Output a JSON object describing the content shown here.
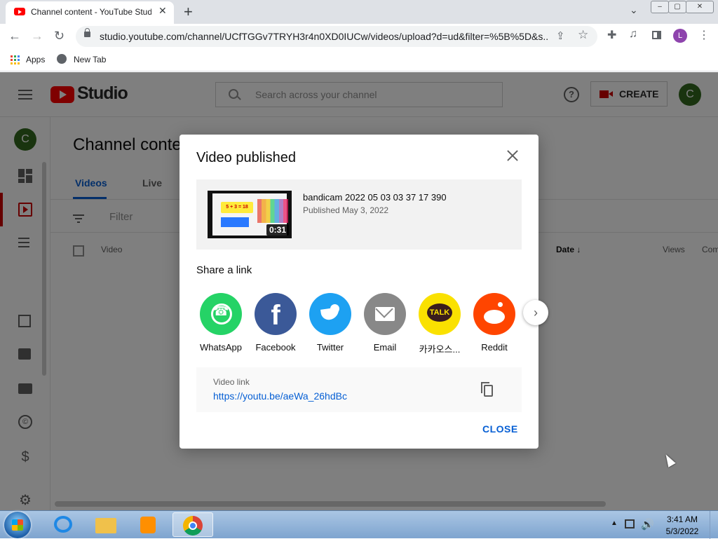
{
  "browser": {
    "tab_title": "Channel content - YouTube Studio",
    "tab_close": "✕",
    "new_tab": "+",
    "tab_search": "⌄",
    "window_min": "–",
    "window_max": "▢",
    "window_close": "✕",
    "back": "←",
    "forward": "→",
    "reload": "↻",
    "url": "studio.youtube.com/channel/UCfTGGv7TRYH3r4n0XD0IUCw/videos/upload?d=ud&filter=%5B%5D&s...",
    "share": "⇪",
    "star": "☆",
    "extensions": "✚",
    "media": "♫",
    "profile_initial": "L",
    "menu": "⋮",
    "profile_color": "#8e44ad"
  },
  "bookmarks": {
    "apps": "Apps",
    "new_tab": "New Tab"
  },
  "studio": {
    "logo_text": "Studio",
    "search_placeholder": "Search across your channel",
    "help": "?",
    "create_label": "CREATE",
    "avatar_initial": "C",
    "page_title": "Channel content",
    "tabs": [
      "Videos",
      "Live"
    ],
    "filter_label": "Filter",
    "columns": {
      "video": "Video",
      "date": "Date ↓",
      "views": "Views",
      "comments": "Com"
    },
    "sidebar_icons": {
      "copyright": "©",
      "earn": "$",
      "settings": "⚙"
    },
    "accent_color": "#cc0000"
  },
  "dialog": {
    "title": "Video published",
    "video_name": "bandicam 2022 05 03 03 37 17 390",
    "published": "Published May 3, 2022",
    "duration": "0:31",
    "thumb_text": "5 + 3 = 18",
    "share_heading": "Share a link",
    "share_targets": [
      {
        "label": "WhatsApp",
        "icon": "whatsapp-icon",
        "color": "#25d366"
      },
      {
        "label": "Facebook",
        "icon": "facebook-icon",
        "color": "#3b5998",
        "glyph": "f"
      },
      {
        "label": "Twitter",
        "icon": "twitter-icon",
        "color": "#1da1f2"
      },
      {
        "label": "Email",
        "icon": "email-icon",
        "color": "#888888"
      },
      {
        "label": "카카오스...",
        "icon": "kakao-icon",
        "color": "#fae100",
        "glyph": "TALK"
      },
      {
        "label": "Reddit",
        "icon": "reddit-icon",
        "color": "#ff4500"
      }
    ],
    "next_arrow": "›",
    "link_label": "Video link",
    "link_url": "https://youtu.be/aeWa_26hdBc",
    "close_button": "CLOSE",
    "link_color": "#065fd4"
  },
  "taskbar": {
    "time": "3:41 AM",
    "date": "5/3/2022",
    "tray_arrow": "▲",
    "volume": "🔊"
  }
}
